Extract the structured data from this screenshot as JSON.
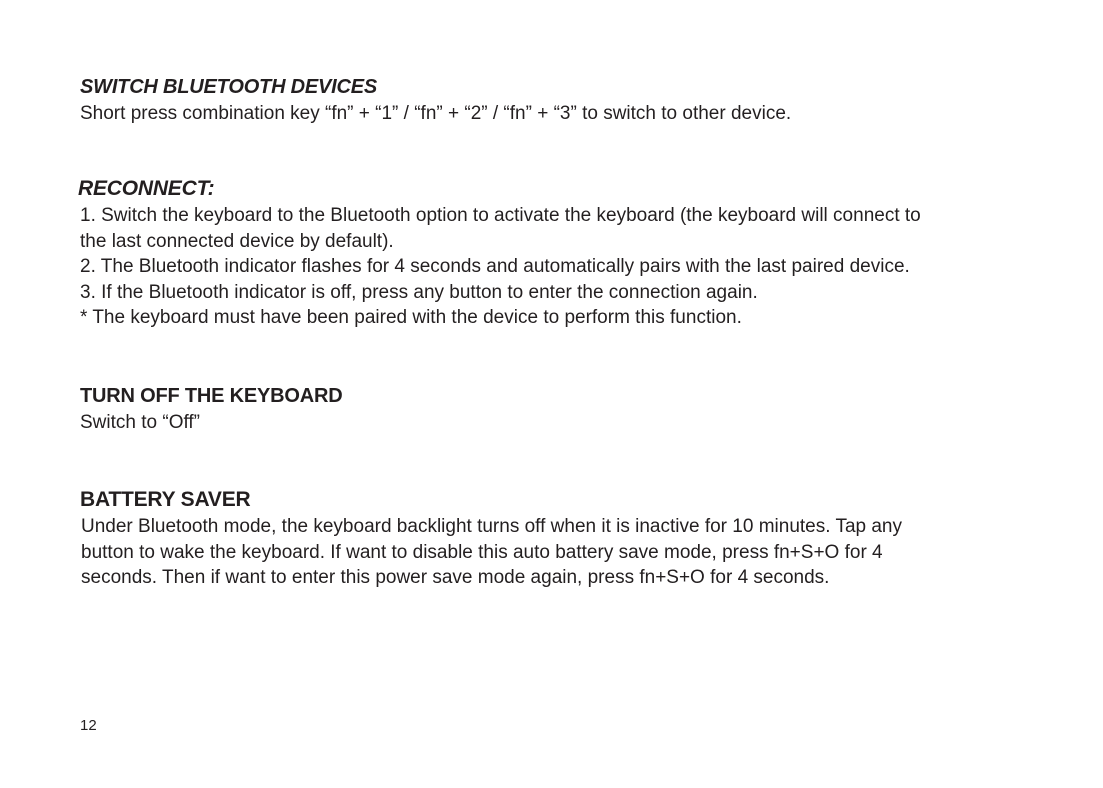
{
  "sections": [
    {
      "heading": "SWITCH BLUETOOTH DEVICES",
      "lines": [
        "Short press combination key “fn” + “1” / “fn” + “2” / “fn” + “3”  to switch to other device."
      ]
    },
    {
      "heading": "RECONNECT:",
      "lines": [
        "1. Switch the keyboard to the Bluetooth option to activate the keyboard (the keyboard will connect to",
        "the last connected device by default).",
        "2. The Bluetooth indicator flashes for 4 seconds and automatically pairs with the last paired device.",
        "3. If the Bluetooth indicator is off, press any button to enter the connection again.",
        "* The keyboard must have been paired with the device to perform this function."
      ]
    },
    {
      "heading": "TURN OFF THE KEYBOARD",
      "lines": [
        "Switch to “Off”"
      ]
    },
    {
      "heading": "BATTERY SAVER",
      "lines": [
        "Under Bluetooth mode, the keyboard backlight turns off when it is inactive for 10 minutes. Tap any",
        "button to wake the keyboard. If want to disable this auto battery save mode, press fn+S+O for 4",
        "seconds. Then if want to enter this power save mode again, press fn+S+O for 4 seconds."
      ]
    }
  ],
  "page_number": "12"
}
